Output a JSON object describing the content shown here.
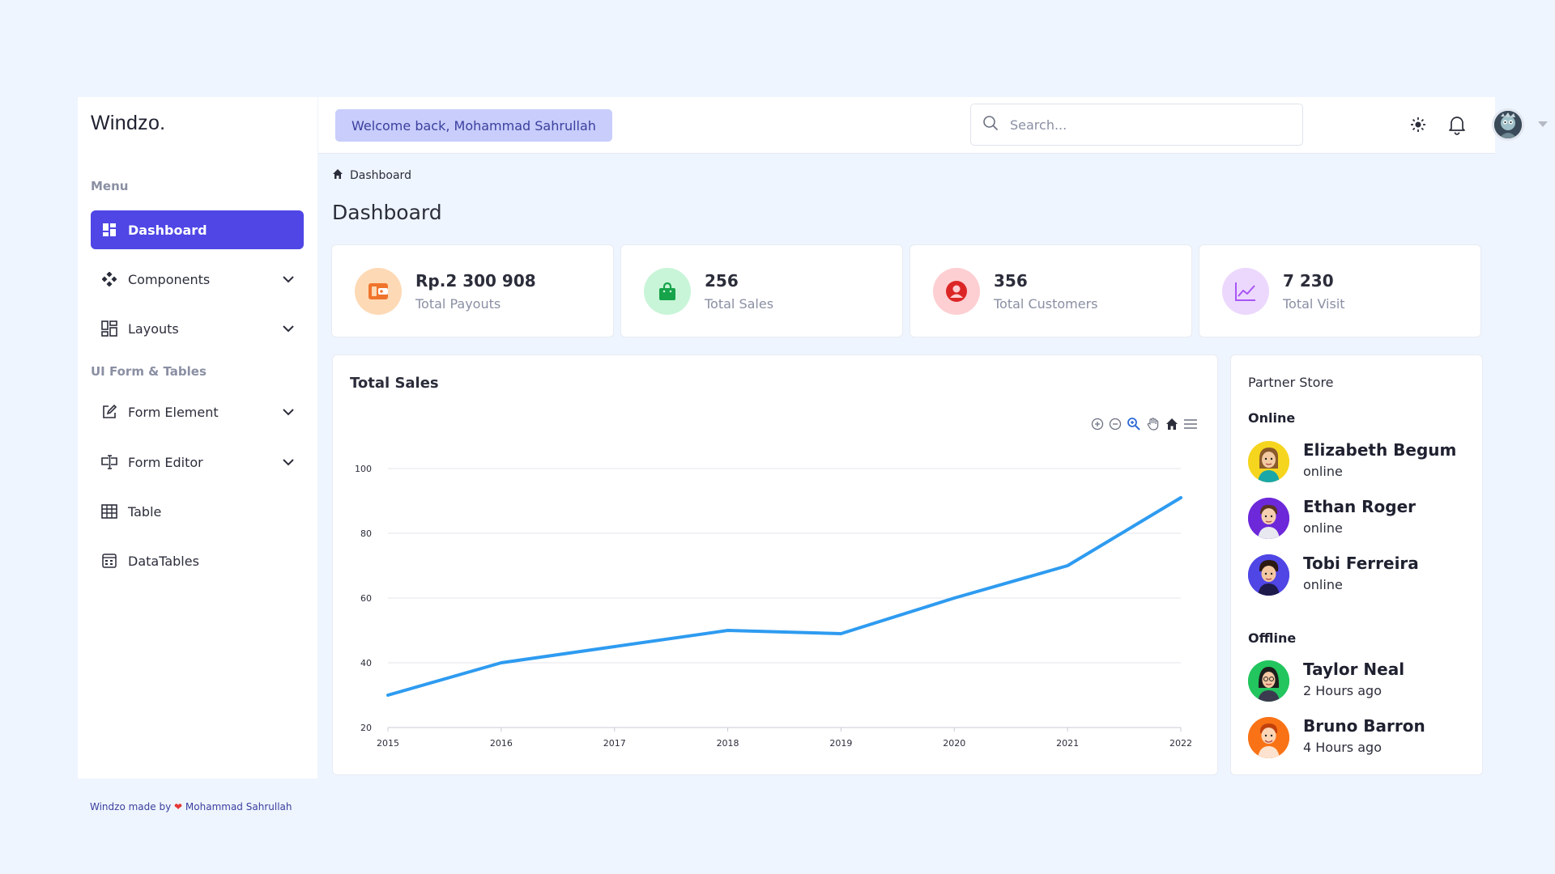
{
  "brand": "Windzo.",
  "sidebar": {
    "menu_heading": "Menu",
    "ui_heading": "UI Form & Tables",
    "items": [
      {
        "label": "Dashboard",
        "icon": "grid-icon",
        "active": true
      },
      {
        "label": "Components",
        "icon": "components-icon",
        "expandable": true
      },
      {
        "label": "Layouts",
        "icon": "layout-icon",
        "expandable": true
      },
      {
        "label": "Form Element",
        "icon": "edit-icon",
        "expandable": true
      },
      {
        "label": "Form Editor",
        "icon": "form-editor-icon",
        "expandable": true
      },
      {
        "label": "Table",
        "icon": "table-icon"
      },
      {
        "label": "DataTables",
        "icon": "datatables-icon"
      }
    ]
  },
  "topbar": {
    "welcome": "Welcome back, Mohammad Sahrullah",
    "search_placeholder": "Search..."
  },
  "breadcrumb": {
    "label": "Dashboard"
  },
  "page_title": "Dashboard",
  "stats": [
    {
      "value": "Rp.2 300 908",
      "label": "Total Payouts",
      "icon": "wallet-icon",
      "bg": "#fdd9b5",
      "fg": "#f0742c"
    },
    {
      "value": "256",
      "label": "Total Sales",
      "icon": "shopping-bag-icon",
      "bg": "#c8f5d8",
      "fg": "#16a34a"
    },
    {
      "value": "356",
      "label": "Total Customers",
      "icon": "user-circle-icon",
      "bg": "#fdcfd2",
      "fg": "#dc2626"
    },
    {
      "value": "7 230",
      "label": "Total Visit",
      "icon": "chart-line-icon",
      "bg": "#ecd8fd",
      "fg": "#a855f7"
    }
  ],
  "chart_data": {
    "type": "line",
    "title": "Total Sales",
    "x": [
      "2015",
      "2016",
      "2017",
      "2018",
      "2019",
      "2020",
      "2021",
      "2022"
    ],
    "series": [
      {
        "values": [
          30,
          40,
          45,
          50,
          49,
          60,
          70,
          91
        ],
        "color": "#2e9bf0"
      }
    ],
    "ylim": [
      20,
      100
    ],
    "yticks": [
      20,
      40,
      60,
      80,
      100
    ],
    "grid": true
  },
  "partner": {
    "title": "Partner Store",
    "online_heading": "Online",
    "offline_heading": "Offline",
    "online": [
      {
        "name": "Elizabeth Begum",
        "status": "online",
        "bg": "#f6d51f"
      },
      {
        "name": "Ethan Roger",
        "status": "online",
        "bg": "#6d28d9"
      },
      {
        "name": "Tobi Ferreira",
        "status": "online",
        "bg": "#4f46e5"
      }
    ],
    "offline": [
      {
        "name": "Taylor Neal",
        "status": "2 Hours ago",
        "bg": "#22c55e"
      },
      {
        "name": "Bruno Barron",
        "status": "4 Hours ago",
        "bg": "#f97316"
      }
    ]
  },
  "footer": {
    "prefix": "Windzo made by",
    "heart": "❤",
    "author": "Mohammad Sahrullah"
  }
}
